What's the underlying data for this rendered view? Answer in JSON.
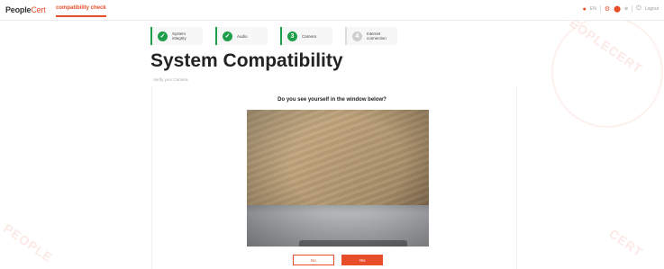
{
  "brand": {
    "logo_main": "People",
    "logo_accent": "Cert"
  },
  "nav": {
    "active_tab": "compatibility check"
  },
  "header_right": {
    "items": [
      "EN",
      "⊕",
      "Logout"
    ]
  },
  "stepper": [
    {
      "label": "System integrity",
      "status": "done"
    },
    {
      "label": "Audio",
      "status": "done"
    },
    {
      "label": "Camera",
      "status": "current",
      "number": "3"
    },
    {
      "label": "Internet connection",
      "status": "pending",
      "number": "4"
    }
  ],
  "page": {
    "title": "System Compatibility",
    "subtitle": "Verify your Camera",
    "question": "Do you see yourself in the window below?"
  },
  "buttons": {
    "no": "No",
    "yes": "Yes"
  },
  "colors": {
    "accent": "#e84d2a",
    "success": "#1f9e4a"
  }
}
